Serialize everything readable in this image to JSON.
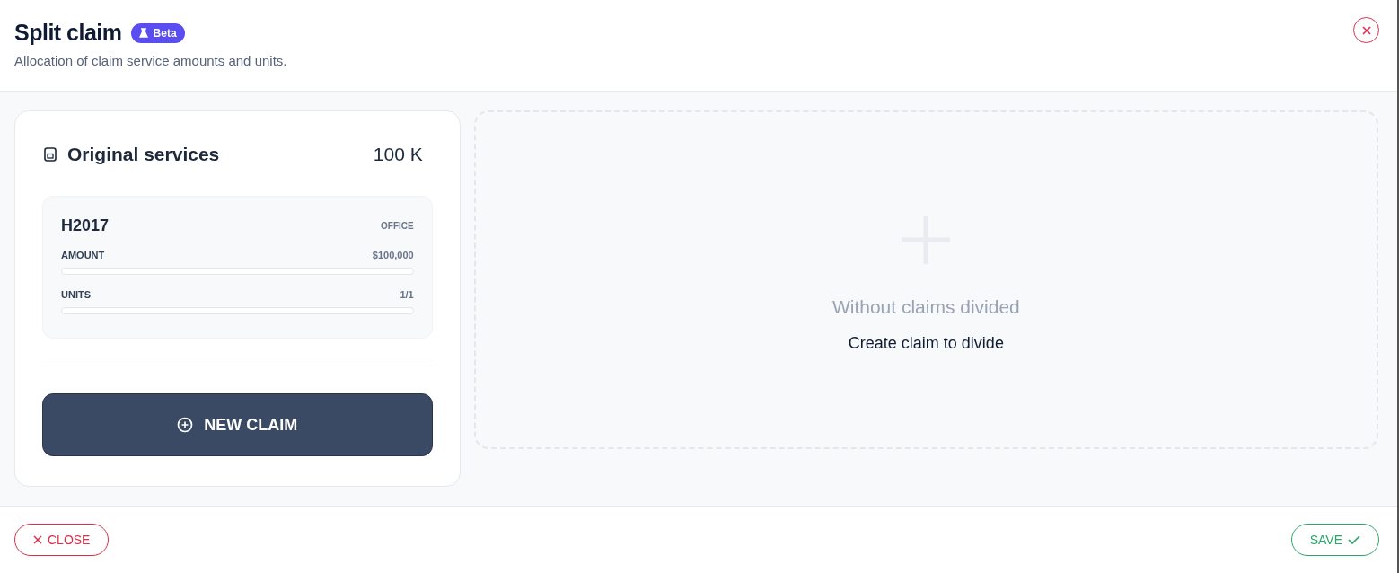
{
  "header": {
    "title": "Split claim",
    "badge": "Beta",
    "subtitle": "Allocation of claim service amounts and units."
  },
  "original": {
    "title": "Original services",
    "total": "100 K",
    "services": [
      {
        "code": "H2017",
        "place": "OFFICE",
        "meters": [
          {
            "label": "AMOUNT",
            "reading": "$100,000",
            "level": 0
          },
          {
            "label": "UNITS",
            "reading": "1/1",
            "level": 0
          }
        ]
      }
    ],
    "new_button": "NEW CLAIM"
  },
  "empty": {
    "title": "Without claims divided",
    "hint": "Create claim to divide"
  },
  "footer": {
    "close": "CLOSE",
    "save": "SAVE"
  }
}
